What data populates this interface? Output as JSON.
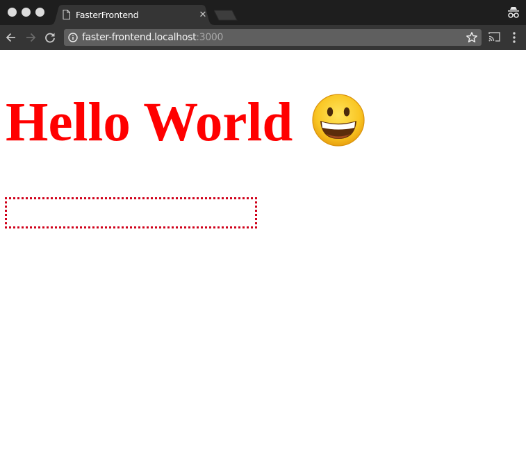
{
  "window": {
    "traffic_lights": [
      "close",
      "minimize",
      "zoom"
    ]
  },
  "tabs": [
    {
      "title": "FasterFrontend",
      "icon": "document-icon",
      "active": true
    }
  ],
  "toolbar": {
    "back_icon": "arrow-left-icon",
    "forward_icon": "arrow-right-icon",
    "reload_icon": "reload-icon",
    "address": {
      "security_icon": "info-icon",
      "host": "faster-frontend.localhost",
      "port": ":3000"
    },
    "bookmark_icon": "star-icon",
    "cast_icon": "cast-icon",
    "menu_icon": "kebab-menu-icon",
    "profile_icon": "incognito-icon"
  },
  "page": {
    "heading": "Hello World",
    "emoji": "grinning-face",
    "heading_color": "#ff0000",
    "box_border_color": "#d0021b"
  }
}
